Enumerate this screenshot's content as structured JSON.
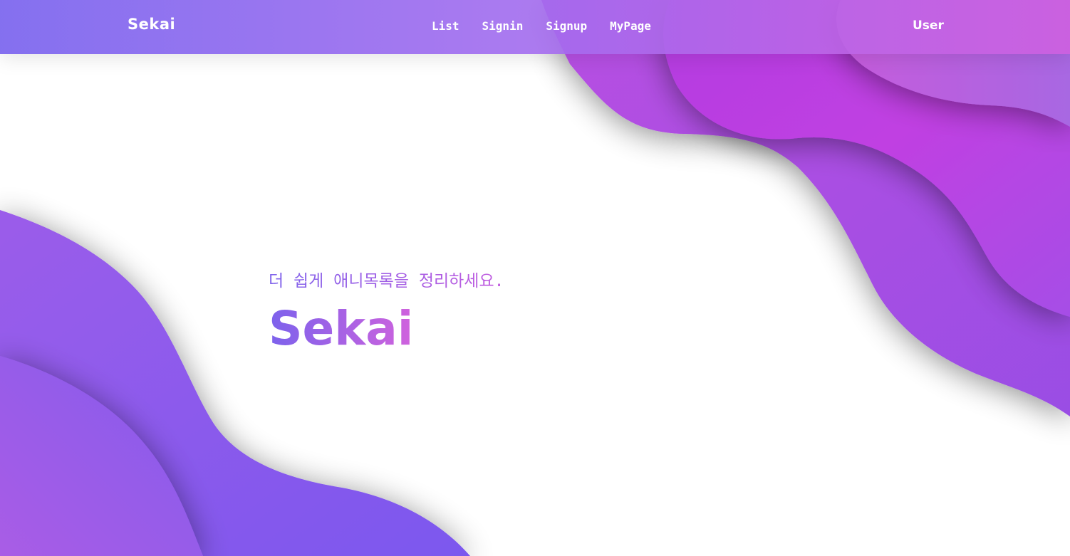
{
  "nav": {
    "brand": "Sekai",
    "links": [
      "List",
      "Signin",
      "Signup",
      "MyPage"
    ],
    "user": "User"
  },
  "hero": {
    "subtitle": "더 쉽게 애니목록을 정리하세요.",
    "title": "Sekai"
  },
  "colors": {
    "gradient_start": "#7a64ee",
    "gradient_mid": "#a36cee",
    "gradient_end": "#c94adf",
    "background": "#ffffff"
  }
}
